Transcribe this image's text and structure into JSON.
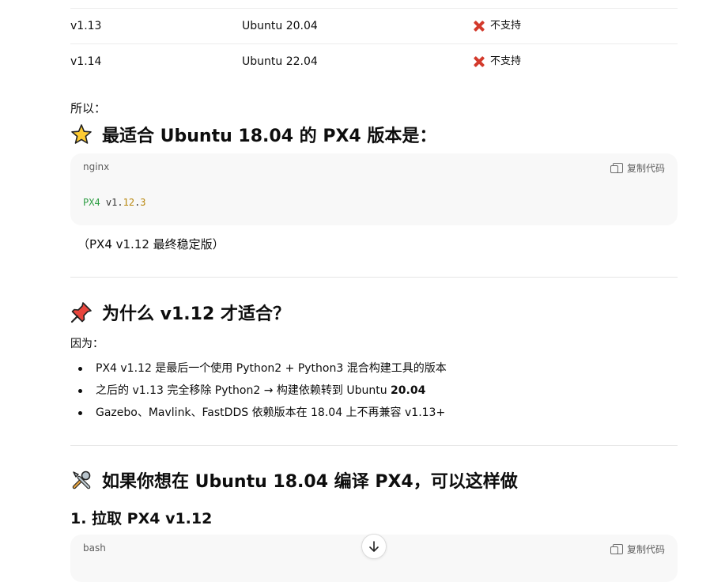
{
  "table": {
    "rows": [
      {
        "version": "v1.13",
        "os": "Ubuntu 20.04",
        "status": "不支持",
        "status_icon": "cross-mark-icon"
      },
      {
        "version": "v1.14",
        "os": "Ubuntu 22.04",
        "status": "不支持",
        "status_icon": "cross-mark-icon"
      }
    ]
  },
  "so_label": "所以：",
  "best_heading": {
    "icon": "star-icon",
    "text": "最适合 Ubuntu 18.04 的 PX4 版本是："
  },
  "code_block_1": {
    "lang": "nginx",
    "copy_label": "复制代码",
    "tokens": {
      "kw": "PX4",
      "plain": "v1.",
      "num1": "12",
      "dot": ".",
      "num2": "3"
    }
  },
  "note": "（PX4 v1.12 最终稳定版）",
  "why_heading": {
    "icon": "pushpin-icon",
    "text": "为什么 v1.12 才适合？"
  },
  "because_label": "因为：",
  "reasons": [
    {
      "text": "PX4 v1.12 是最后一个使用 Python2 + Python3 混合构建工具的版本",
      "bold": ""
    },
    {
      "text": "之后的 v1.13 完全移除 Python2 → 构建依赖转到 Ubuntu ",
      "bold": "20.04"
    },
    {
      "text": "Gazebo、Mavlink、FastDDS 依赖版本在 18.04 上不再兼容 v1.13+",
      "bold": ""
    }
  ],
  "how_heading": {
    "icon": "tools-icon",
    "text": "如果你想在 Ubuntu 18.04 编译 PX4，可以这样做"
  },
  "step1_heading": "1. 拉取 PX4 v1.12",
  "code_block_2": {
    "lang": "bash",
    "copy_label": "复制代码"
  },
  "scroll_button_icon": "arrow-down-icon",
  "colors": {
    "cross": "#d33a2c",
    "code_bg": "#f8f8f8",
    "keyword": "#2f9e44",
    "number": "#b8860b"
  }
}
